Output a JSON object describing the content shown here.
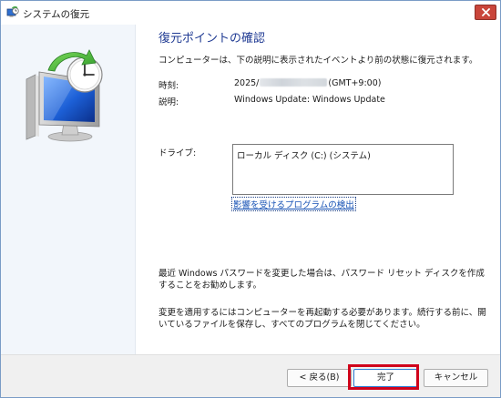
{
  "window": {
    "title": "システムの復元",
    "icons": {
      "title": "system-restore-icon",
      "close": "close-icon",
      "hero": "system-restore-monitor-clock-icon"
    }
  },
  "content": {
    "heading": "復元ポイントの確認",
    "intro": "コンピューターは、下の説明に表示されたイベントより前の状態に復元されます。",
    "time_label": "時刻:",
    "time_year": "2025/",
    "time_tz": "(GMT+9:00)",
    "description_label": "説明:",
    "description_value": "Windows Update: Windows Update",
    "drive_label": "ドライブ:",
    "drives": [
      "ローカル ディスク (C:) (システム)"
    ],
    "scan_link": "影響を受けるプログラムの検出",
    "note_password": "最近 Windows パスワードを変更した場合は、パスワード リセット ディスクを作成することをお勧めします。",
    "note_restart": "変更を適用するにはコンピューターを再起動する必要があります。続行する前に、開いているファイルを保存し、すべてのプログラムを閉じてください。"
  },
  "buttons": {
    "back": "< 戻る(B)",
    "finish": "完了",
    "cancel": "キャンセル"
  },
  "colors": {
    "heading": "#1f3a93",
    "link": "#1450b4",
    "highlight": "#d0021b",
    "close_button": "#c9453a"
  }
}
